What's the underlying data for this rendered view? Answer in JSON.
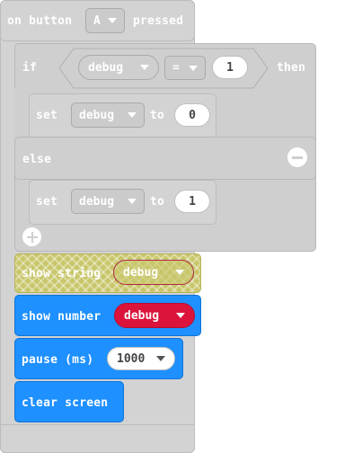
{
  "event_block": {
    "prefix": "on button",
    "button_value": "A",
    "suffix": "pressed"
  },
  "if_block": {
    "if_label": "if",
    "variable": "debug",
    "operator": "=",
    "compare_value": "1",
    "then_label": "then",
    "else_label": "else"
  },
  "set_block_1": {
    "set_label": "set",
    "variable": "debug",
    "to_label": "to",
    "value": "0"
  },
  "set_block_2": {
    "set_label": "set",
    "variable": "debug",
    "to_label": "to",
    "value": "1"
  },
  "show_string": {
    "label": "show string",
    "variable": "debug"
  },
  "show_number": {
    "label": "show number",
    "variable": "debug"
  },
  "pause": {
    "label": "pause (ms)",
    "value": "1000"
  },
  "clear_screen": {
    "label": "clear screen"
  },
  "colors": {
    "event_gray": "#d3d3d3",
    "basic_blue": "#1e90ff",
    "variable_red": "#dc143c",
    "hatched_yellow": "#c8c66a"
  }
}
